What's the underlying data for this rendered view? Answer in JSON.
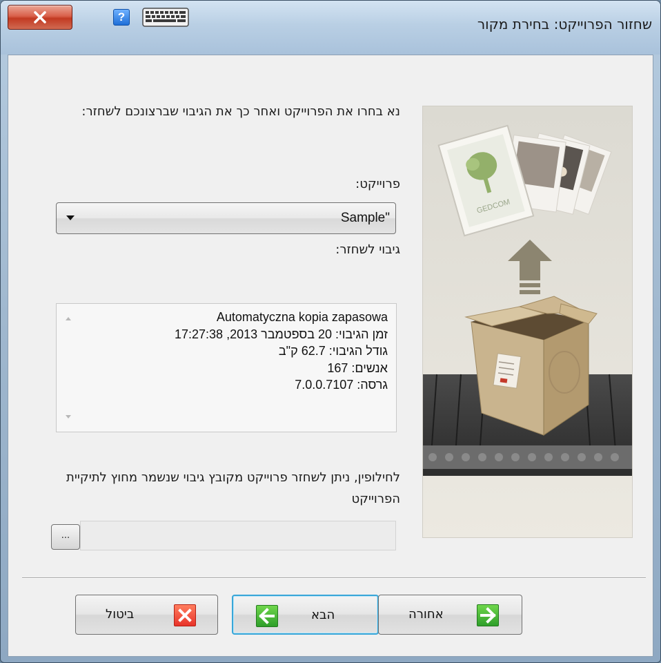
{
  "window": {
    "title": "שחזור הפרוייקט: בחירת מקור",
    "help_label": "?"
  },
  "content": {
    "instruction": "נא בחרו את הפרוייקט ואחר כך את הגיבוי שברצונכם לשחזר:",
    "project_label": "פרוייקט:",
    "project_selected": "\"Sample",
    "backup_label": "גיבוי לשחזר:",
    "backup_item": {
      "name": "Automatyczna kopia zapasowa",
      "time": "זמן הגיבוי: 20 בספטמבר 2013, 17:27:38",
      "size": "גודל הגיבוי: 62.7 ק\"ב",
      "people": "אנשים: 167",
      "version": "גרסה: 7.0.0.7107"
    },
    "alternative_text": "לחילופין, ניתן לשחזר פרוייקט מקובץ גיבוי שנשמר מחוץ לתיקיית הפרוייקט",
    "browse_label": "...",
    "path_value": ""
  },
  "buttons": {
    "cancel": "ביטול",
    "next": "הבא",
    "back": "אחורה"
  },
  "illustration": {
    "card_logo_text": "GEDCOM"
  },
  "colors": {
    "next_focus": "#38a6d8",
    "cancel_icon": "#e8332a",
    "arrow_icon": "#2f9f2a",
    "close_button": "#c23a22"
  }
}
